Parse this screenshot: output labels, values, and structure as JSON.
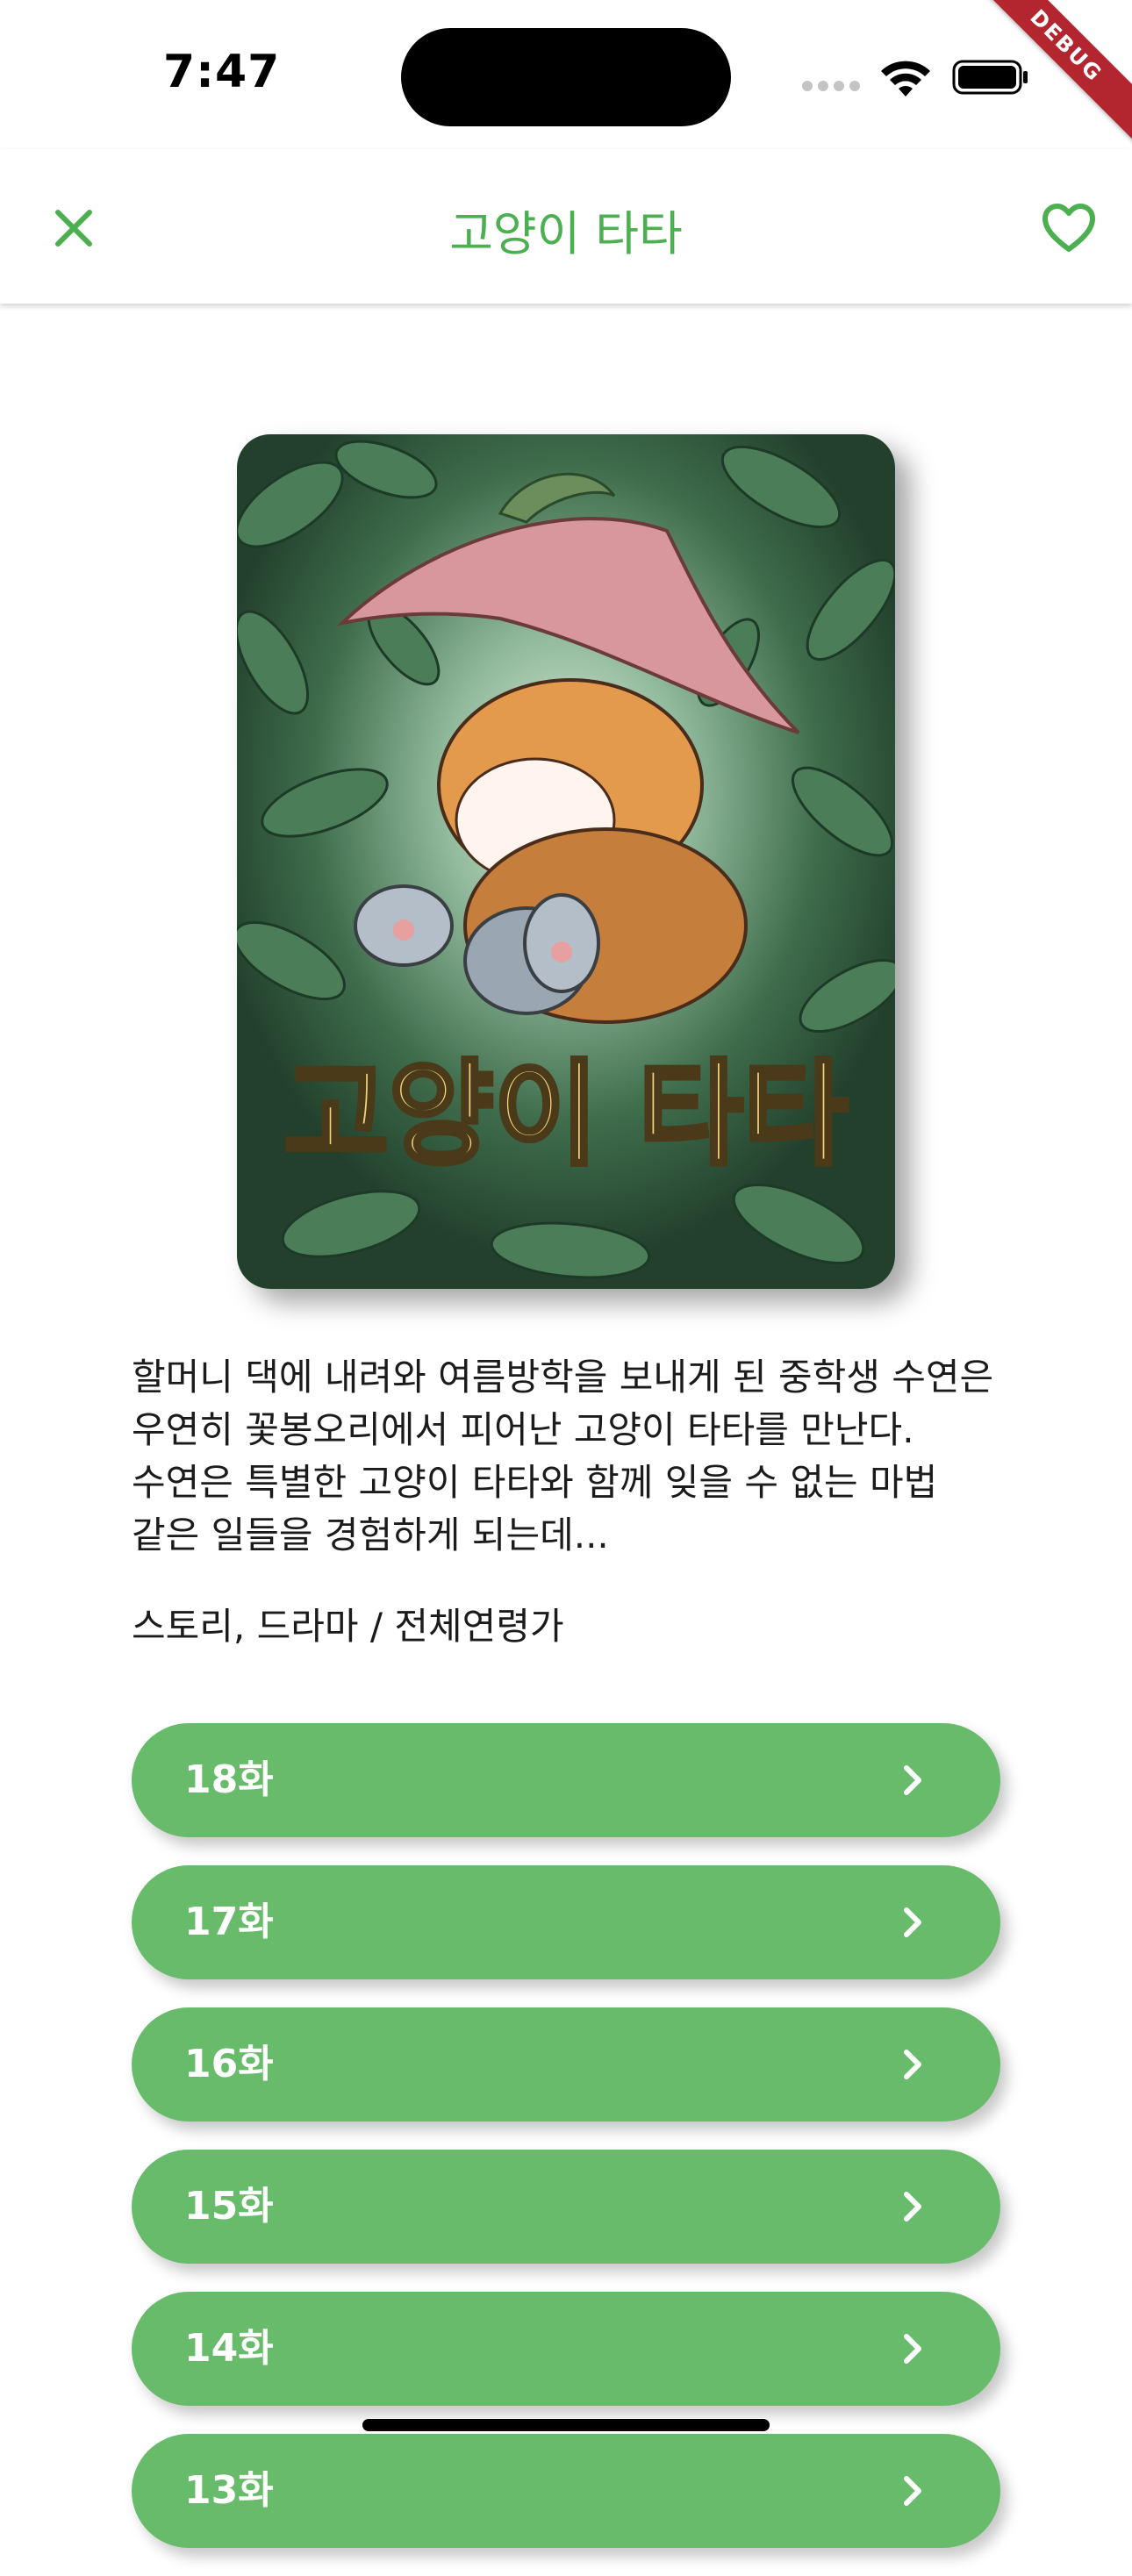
{
  "status_bar": {
    "time": "7:47",
    "debug_label": "DEBUG"
  },
  "app_bar": {
    "title": "고양이 타타",
    "close_icon": "close-icon",
    "favorite_icon": "heart-outline-icon"
  },
  "cover": {
    "title_text": "고양이 타타"
  },
  "description": "할머니 댁에 내려와 여름방학을 보내게 된 중학생 수연은 우연히  꽃봉오리에서 피어난 고양이 타타를 만난다. 수연은 특별한 고양이 타타와 함께 잊을 수 없는 마법 같은 일들을 경험하게 되는데...",
  "genre": "스토리, 드라마 / 전체연령가",
  "episodes": [
    {
      "label": "18화"
    },
    {
      "label": "17화"
    },
    {
      "label": "16화"
    },
    {
      "label": "15화"
    },
    {
      "label": "14화"
    },
    {
      "label": "13화"
    }
  ],
  "colors": {
    "accent": "#4caf50",
    "episode_button": "#67bb6a",
    "debug_banner": "#b3262f"
  }
}
